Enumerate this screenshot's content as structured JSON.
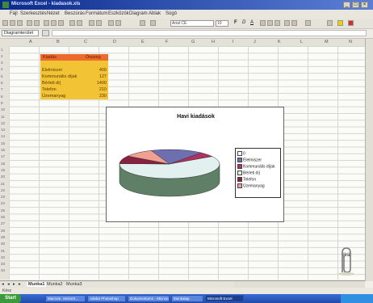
{
  "window": {
    "title": "Microsoft Excel - kiadasok.xls"
  },
  "menu": [
    "Fájl",
    "Szerkesztés",
    "Nézet",
    "Beszúrás",
    "Formátum",
    "Eszközök",
    "Diagram",
    "Ablak",
    "Súgó"
  ],
  "toolbar": {
    "font": "Arial CE",
    "size": "10",
    "bold": "F",
    "italic": "D",
    "underline": "A"
  },
  "formula_bar": {
    "name_box": "Diagramterület"
  },
  "columns": [
    "A",
    "B",
    "C",
    "D",
    "E",
    "F",
    "G",
    "H",
    "I",
    "J",
    "K",
    "L",
    "M",
    "N"
  ],
  "rows": [
    "1",
    "2",
    "3",
    "4",
    "5",
    "6",
    "7",
    "8",
    "9",
    "10",
    "11",
    "12",
    "13",
    "14",
    "15",
    "16",
    "17",
    "18",
    "19",
    "20",
    "21",
    "22",
    "23",
    "24",
    "25",
    "26",
    "27",
    "28",
    "29",
    "30",
    "31",
    "32",
    "33",
    "34"
  ],
  "table": {
    "headers": [
      "Kiadás",
      "Összeg"
    ],
    "rows": [
      {
        "label": "Élelmiszer",
        "value": "400"
      },
      {
        "label": "Kommunális díjak",
        "value": "127"
      },
      {
        "label": "Bérleti díj",
        "value": "1400"
      },
      {
        "label": "Telefon",
        "value": "210"
      },
      {
        "label": "Üzemanyag",
        "value": "230"
      }
    ]
  },
  "chart_data": {
    "type": "pie",
    "title": "Havi kiadások",
    "categories": [
      "Élelmiszer",
      "Kommunális díjak",
      "Bérleti díj",
      "Telefon",
      "Üzemanyag"
    ],
    "values": [
      400,
      127,
      1400,
      210,
      230
    ],
    "colors": [
      "#6e6fb0",
      "#b03060",
      "#e2f0f0",
      "#8a2040",
      "#f0a090"
    ],
    "legend_placement": "right",
    "legend_extra_entry": "0"
  },
  "sheets": [
    "Munka1",
    "Munka2",
    "Munka3"
  ],
  "status": "Kész",
  "taskbar": {
    "start": "Start",
    "tasks": [
      "Macrom. VectorX...",
      "Adobe Photoshop",
      "Dokumentum1 - Microsoft Word",
      "Munkalap",
      "Microsoft Excel"
    ]
  }
}
